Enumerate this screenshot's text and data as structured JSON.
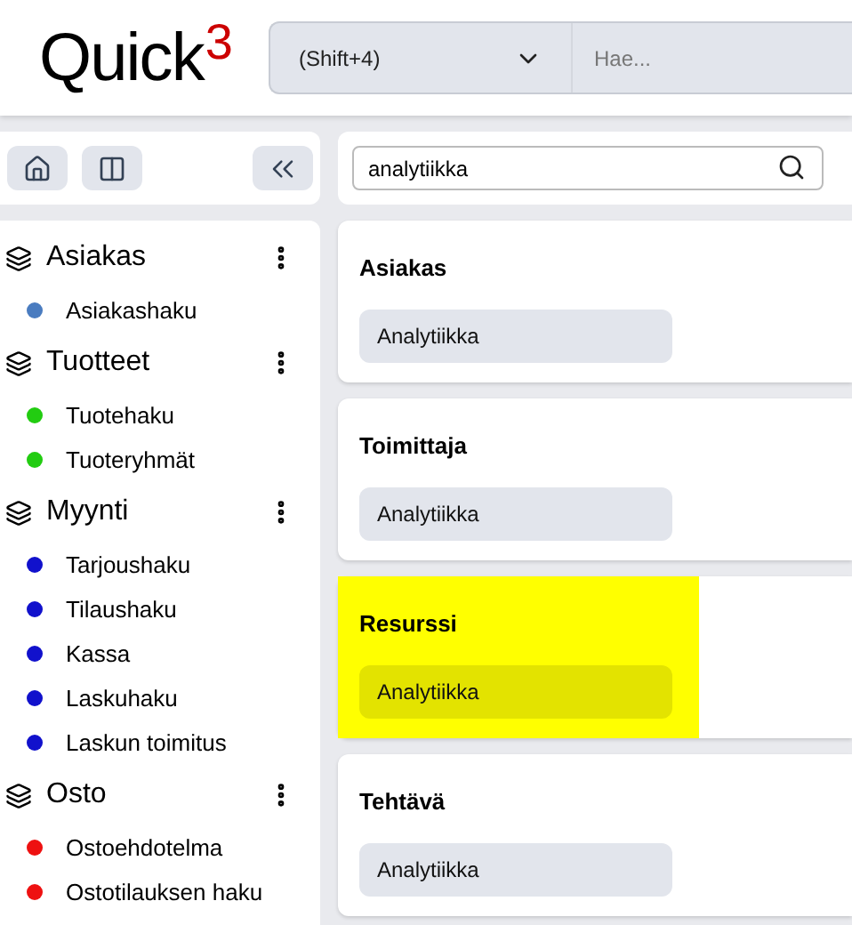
{
  "header": {
    "logo": {
      "text": "Quick",
      "superscript": "3"
    },
    "search_bar": {
      "shortcut": "(Shift+4)",
      "placeholder": "Hae..."
    }
  },
  "sidebar_toolbar": {
    "buttons": [
      {
        "kind": "home"
      },
      {
        "kind": "layout"
      },
      {
        "kind": "collapse"
      }
    ]
  },
  "sidebar": {
    "groups": [
      {
        "title": "Asiakas",
        "items": [
          {
            "label": "Asiakashaku",
            "color": "#4a7cc0"
          }
        ]
      },
      {
        "title": "Tuotteet",
        "items": [
          {
            "label": "Tuotehaku",
            "color": "#22cc11"
          },
          {
            "label": "Tuoteryhmät",
            "color": "#22cc11"
          }
        ]
      },
      {
        "title": "Myynti",
        "items": [
          {
            "label": "Tarjoushaku",
            "color": "#1111cc"
          },
          {
            "label": "Tilaushaku",
            "color": "#1111cc"
          },
          {
            "label": "Kassa",
            "color": "#1111cc"
          },
          {
            "label": "Laskuhaku",
            "color": "#1111cc"
          },
          {
            "label": "Laskun toimitus",
            "color": "#1111cc"
          }
        ]
      },
      {
        "title": "Osto",
        "items": [
          {
            "label": "Ostoehdotelma",
            "color": "#ee1111"
          },
          {
            "label": "Ostotilauksen haku",
            "color": "#ee1111"
          }
        ]
      }
    ]
  },
  "search": {
    "value": "analytiikka"
  },
  "results": [
    {
      "title": "Asiakas",
      "highlighted": false,
      "links": [
        "Analytiikka"
      ]
    },
    {
      "title": "Toimittaja",
      "highlighted": false,
      "links": [
        "Analytiikka"
      ]
    },
    {
      "title": "Resurssi",
      "highlighted": true,
      "links": [
        "Analytiikka"
      ]
    },
    {
      "title": "Tehtävä",
      "highlighted": false,
      "links": [
        "Analytiikka"
      ]
    }
  ]
}
